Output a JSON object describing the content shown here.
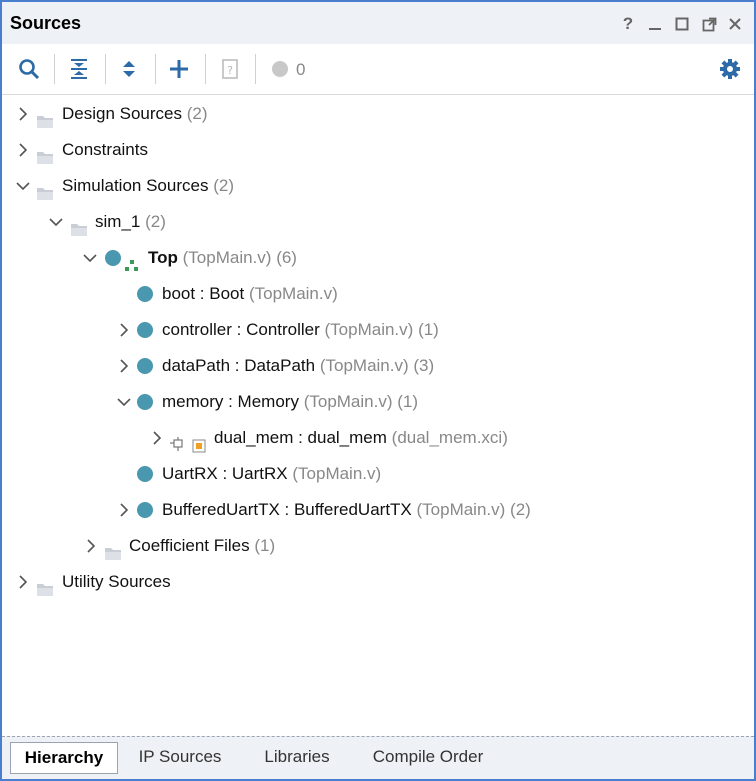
{
  "panel": {
    "title": "Sources",
    "help_label": "?",
    "status_count": "0"
  },
  "icons": {
    "search": "search-icon",
    "collapse_all": "collapse-all-icon",
    "expand_all": "expand-all-icon",
    "add": "plus-icon",
    "unknown": "question-doc-icon",
    "status": "status-circle-icon",
    "settings": "gear-icon"
  },
  "colors": {
    "accent": "#2d6aa8",
    "module_dot": "#4a98b0",
    "folder": "#c9ced6",
    "ip_orange": "#f0a020"
  },
  "tree": {
    "design_sources": {
      "label": "Design Sources",
      "count": "(2)"
    },
    "constraints": {
      "label": "Constraints"
    },
    "simulation_sources": {
      "label": "Simulation Sources",
      "count": "(2)"
    },
    "sim_1": {
      "label": "sim_1",
      "count": "(2)"
    },
    "top": {
      "label": "Top",
      "file": "(TopMain.v)",
      "count": "(6)"
    },
    "boot": {
      "label": "boot : Boot",
      "file": "(TopMain.v)"
    },
    "controller": {
      "label": "controller : Controller",
      "file": "(TopMain.v)",
      "count": "(1)"
    },
    "datapath": {
      "label": "dataPath : DataPath",
      "file": "(TopMain.v)",
      "count": "(3)"
    },
    "memory": {
      "label": "memory : Memory",
      "file": "(TopMain.v)",
      "count": "(1)"
    },
    "dual_mem": {
      "label": "dual_mem : dual_mem",
      "file": "(dual_mem.xci)"
    },
    "uartrx": {
      "label": "UartRX : UartRX",
      "file": "(TopMain.v)"
    },
    "bufferedtx": {
      "label": "BufferedUartTX : BufferedUartTX",
      "file": "(TopMain.v)",
      "count": "(2)"
    },
    "coefficient_files": {
      "label": "Coefficient Files",
      "count": "(1)"
    },
    "utility_sources": {
      "label": "Utility Sources"
    }
  },
  "tabs": [
    "Hierarchy",
    "IP Sources",
    "Libraries",
    "Compile Order"
  ]
}
